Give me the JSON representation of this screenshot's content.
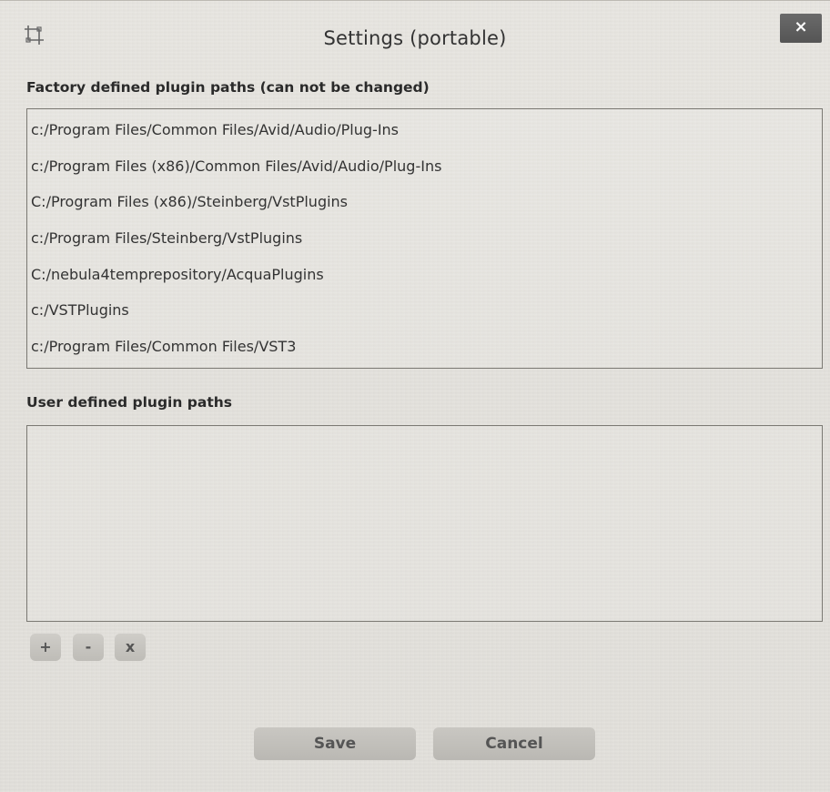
{
  "window": {
    "title": "Settings (portable)",
    "close_label": "×",
    "app_icon": "crop-icon"
  },
  "factory": {
    "label": "Factory defined plugin paths (can not be changed)",
    "paths": [
      "c:/Program Files/Common Files/Avid/Audio/Plug-Ins",
      "c:/Program Files (x86)/Common Files/Avid/Audio/Plug-Ins",
      "C:/Program Files (x86)/Steinberg/VstPlugins",
      "c:/Program Files/Steinberg/VstPlugins",
      "C:/nebula4temprepository/AcquaPlugins",
      "c:/VSTPlugins",
      "c:/Program Files/Common Files/VST3"
    ]
  },
  "user": {
    "label": "User defined plugin paths",
    "paths": []
  },
  "path_buttons": {
    "add_label": "+",
    "remove_label": "-",
    "clear_label": "x"
  },
  "dialog_buttons": {
    "save_label": "Save",
    "cancel_label": "Cancel"
  },
  "colors": {
    "background": "#e3e1dc",
    "close_button": "#5f5f5f",
    "button": "#c4c2bd",
    "border": "#7a7872"
  }
}
